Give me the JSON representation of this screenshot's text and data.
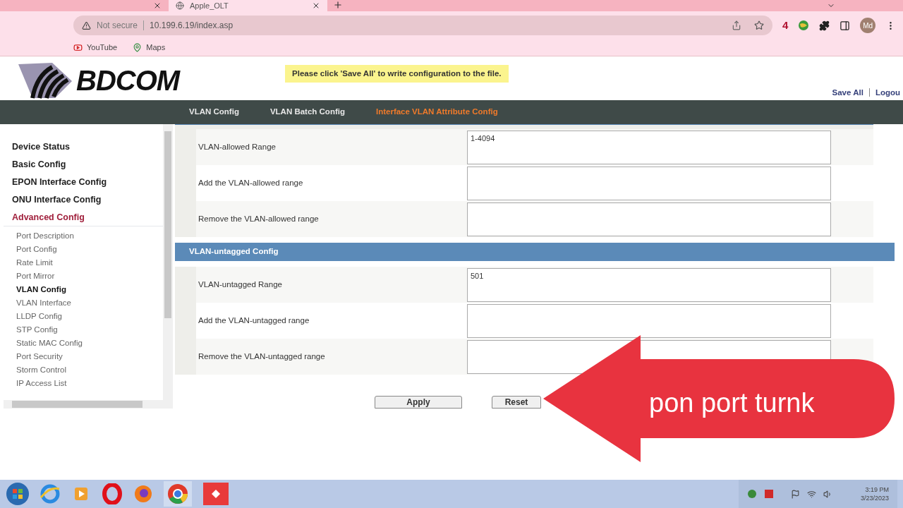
{
  "browser": {
    "tabs": [
      {
        "selected": false
      },
      {
        "title": "Apple_OLT",
        "selected": true
      }
    ],
    "security": "Not secure",
    "url": "10.199.6.19/index.asp",
    "extension_badge": "4",
    "avatar": "Md",
    "bookmarks": [
      "YouTube",
      "Maps"
    ]
  },
  "header": {
    "logo": "BDCOM",
    "notice": "Please click 'Save All' to write configuration to the file.",
    "links": [
      "Save All",
      "Logou"
    ]
  },
  "nav": [
    {
      "label": "VLAN Config",
      "selected": false
    },
    {
      "label": "VLAN Batch Config",
      "selected": false
    },
    {
      "label": "Interface VLAN Attribute Config",
      "selected": true
    }
  ],
  "sidebar": [
    {
      "label": "Device Status",
      "kind": "section",
      "selected": false
    },
    {
      "label": "Basic Config",
      "kind": "section",
      "selected": false
    },
    {
      "label": "EPON Interface Config",
      "kind": "section",
      "selected": false
    },
    {
      "label": "ONU Interface Config",
      "kind": "section",
      "selected": false
    },
    {
      "label": "Advanced Config",
      "kind": "section",
      "selected": true
    },
    {
      "label": "Port Description",
      "kind": "sub",
      "selected": false
    },
    {
      "label": "Port Config",
      "kind": "sub",
      "selected": false
    },
    {
      "label": "Rate Limit",
      "kind": "sub",
      "selected": false
    },
    {
      "label": "Port Mirror",
      "kind": "sub",
      "selected": false
    },
    {
      "label": "VLAN Config",
      "kind": "sub",
      "selected": true
    },
    {
      "label": "VLAN Interface",
      "kind": "sub",
      "selected": false
    },
    {
      "label": "LLDP Config",
      "kind": "sub",
      "selected": false
    },
    {
      "label": "STP Config",
      "kind": "sub",
      "selected": false
    },
    {
      "label": "Static MAC Config",
      "kind": "sub",
      "selected": false
    },
    {
      "label": "Port Security",
      "kind": "sub",
      "selected": false
    },
    {
      "label": "Storm Control",
      "kind": "sub",
      "selected": false
    },
    {
      "label": "IP Access List",
      "kind": "sub",
      "selected": false
    }
  ],
  "sections": [
    {
      "rows": [
        {
          "label": "VLAN-allowed Range",
          "value": "1-4094"
        },
        {
          "label": "Add the VLAN-allowed range"
        },
        {
          "label": "Remove the VLAN-allowed range"
        }
      ]
    },
    {
      "title": "VLAN-untagged Config",
      "rows": [
        {
          "label": "VLAN-untagged Range",
          "value": "501"
        },
        {
          "label": "Add the VLAN-untagged range"
        },
        {
          "label": "Remove the VLAN-untagged range"
        }
      ]
    }
  ],
  "buttons": [
    "Apply",
    "Reset"
  ],
  "callout": "pon port turnk",
  "taskbar": {
    "time": "3:19 PM",
    "date": "3/23/2023"
  }
}
